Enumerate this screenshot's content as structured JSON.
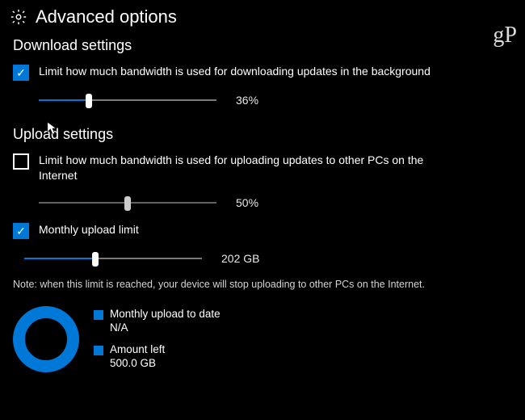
{
  "header": {
    "title": "Advanced options"
  },
  "watermark": "gP",
  "download": {
    "section_title": "Download settings",
    "limit_label": "Limit how much bandwidth is used for downloading updates in the background",
    "limit_checked": true,
    "slider_percent": 36,
    "slider_display": "36%"
  },
  "upload": {
    "section_title": "Upload settings",
    "limit_label": "Limit how much bandwidth is used for uploading updates to other PCs on the Internet",
    "limit_checked": false,
    "slider_percent": 50,
    "slider_display": "50%",
    "monthly_limit_label": "Monthly upload limit",
    "monthly_limit_checked": true,
    "monthly_slider_percent": 40,
    "monthly_slider_display": "202 GB",
    "note": "Note: when this limit is reached, your device will stop uploading to other PCs on the Internet.",
    "legend": {
      "uploaded_label": "Monthly upload to date",
      "uploaded_value": "N/A",
      "left_label": "Amount left",
      "left_value": "500.0 GB"
    }
  }
}
